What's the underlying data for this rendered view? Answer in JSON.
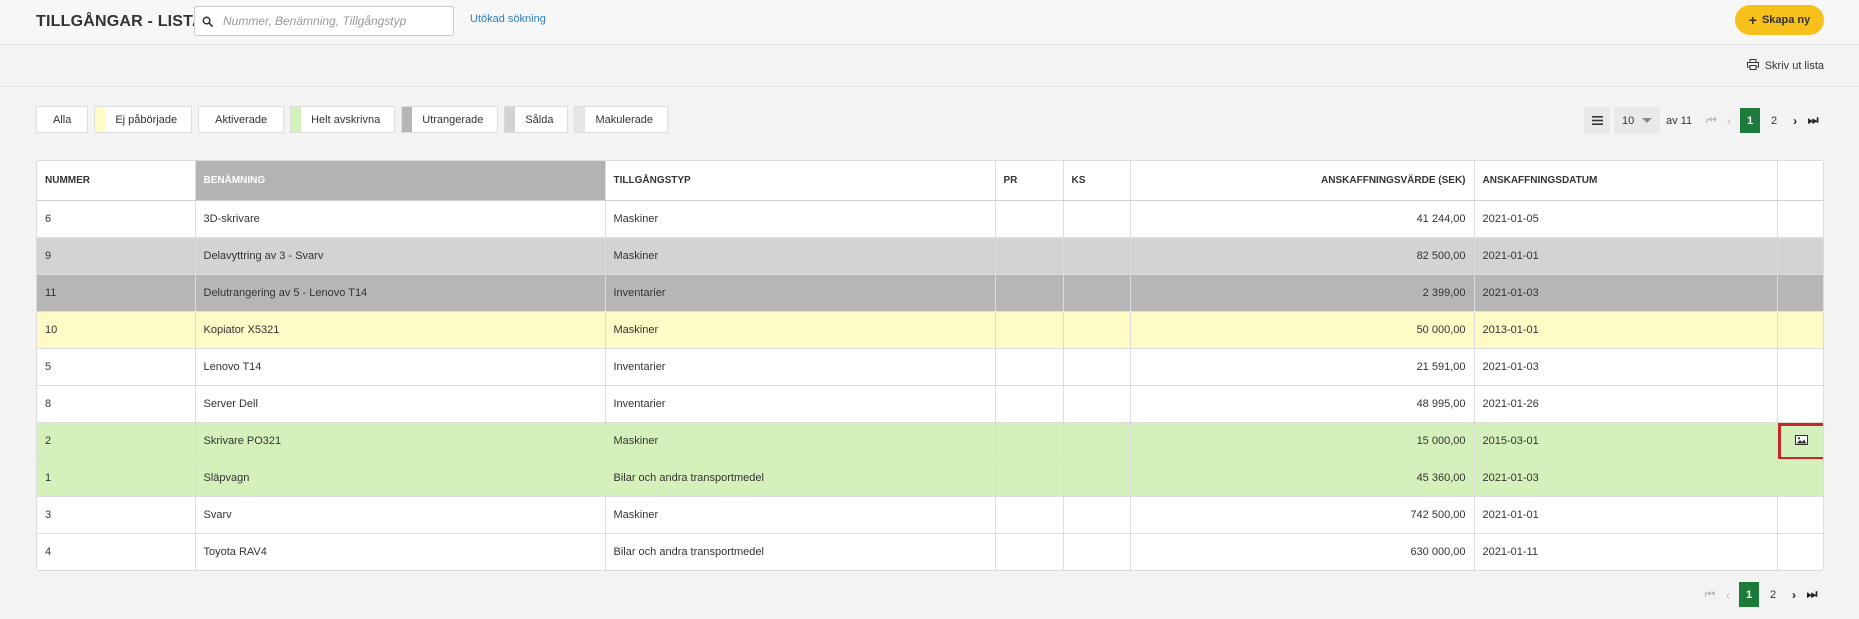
{
  "header": {
    "title": "TILLGÅNGAR - LISTA",
    "search_placeholder": "Nummer, Benämning, Tillgångstyp",
    "search_value": "",
    "advanced_search": "Utökad sökning",
    "create_new": "Skapa ny"
  },
  "toolbar": {
    "print_label": "Skriv ut lista"
  },
  "filters": [
    {
      "label": "Alla",
      "color": ""
    },
    {
      "label": "Ej påbörjade",
      "color": "#fffbc7"
    },
    {
      "label": "Aktiverade",
      "color": ""
    },
    {
      "label": "Helt avskrivna",
      "color": "#d5f1bb"
    },
    {
      "label": "Utrangerade",
      "color": "#b6b6b6"
    },
    {
      "label": "Sålda",
      "color": "#d3d3d3"
    },
    {
      "label": "Makulerade",
      "color": "#e6e6e6"
    }
  ],
  "pagination": {
    "page_size": "10",
    "of_label": "av 11",
    "current_page": "1",
    "next_page": "2",
    "accent_color": "#1c7a3a"
  },
  "table": {
    "columns": {
      "number": "NUMMER",
      "name": "BENÄMNING",
      "type": "TILLGÅNGSTYP",
      "pr": "PR",
      "ks": "KS",
      "value": "ANSKAFFNINGSVÄRDE (SEK)",
      "date": "ANSKAFFNINGSDATUM"
    },
    "rows": [
      {
        "number": "6",
        "name": "3D-skrivare",
        "type": "Maskiner",
        "pr": "",
        "ks": "",
        "value": "41 244,00",
        "date": "2021-01-05",
        "status": "white"
      },
      {
        "number": "9",
        "name": "Delavyttring av 3 - Svarv",
        "type": "Maskiner",
        "pr": "",
        "ks": "",
        "value": "82 500,00",
        "date": "2021-01-01",
        "status": "sold"
      },
      {
        "number": "11",
        "name": "Delutrangering av 5 - Lenovo T14",
        "type": "Inventarier",
        "pr": "",
        "ks": "",
        "value": "2 399,00",
        "date": "2021-01-03",
        "status": "retired"
      },
      {
        "number": "10",
        "name": "Kopiator X5321",
        "type": "Maskiner",
        "pr": "",
        "ks": "",
        "value": "50 000,00",
        "date": "2013-01-01",
        "status": "notstarted"
      },
      {
        "number": "5",
        "name": "Lenovo T14",
        "type": "Inventarier",
        "pr": "",
        "ks": "",
        "value": "21 591,00",
        "date": "2021-01-03",
        "status": "white"
      },
      {
        "number": "8",
        "name": "Server Dell",
        "type": "Inventarier",
        "pr": "",
        "ks": "",
        "value": "48 995,00",
        "date": "2021-01-26",
        "status": "white"
      },
      {
        "number": "2",
        "name": "Skrivare PO321",
        "type": "Maskiner",
        "pr": "",
        "ks": "",
        "value": "15 000,00",
        "date": "2015-03-01",
        "status": "depreciated",
        "icon": "image-icon"
      },
      {
        "number": "1",
        "name": "Släpvagn",
        "type": "Bilar och andra transportmedel",
        "pr": "",
        "ks": "",
        "value": "45 360,00",
        "date": "2021-01-03",
        "status": "depreciated"
      },
      {
        "number": "3",
        "name": "Svarv",
        "type": "Maskiner",
        "pr": "",
        "ks": "",
        "value": "742 500,00",
        "date": "2021-01-01",
        "status": "white"
      },
      {
        "number": "4",
        "name": "Toyota RAV4",
        "type": "Bilar och andra transportmedel",
        "pr": "",
        "ks": "",
        "value": "630 000,00",
        "date": "2021-01-11",
        "status": "white"
      }
    ]
  },
  "colors": {
    "create_button": "#f7c01a",
    "highlight_border": "#c62828",
    "link": "#2a7fc1"
  }
}
